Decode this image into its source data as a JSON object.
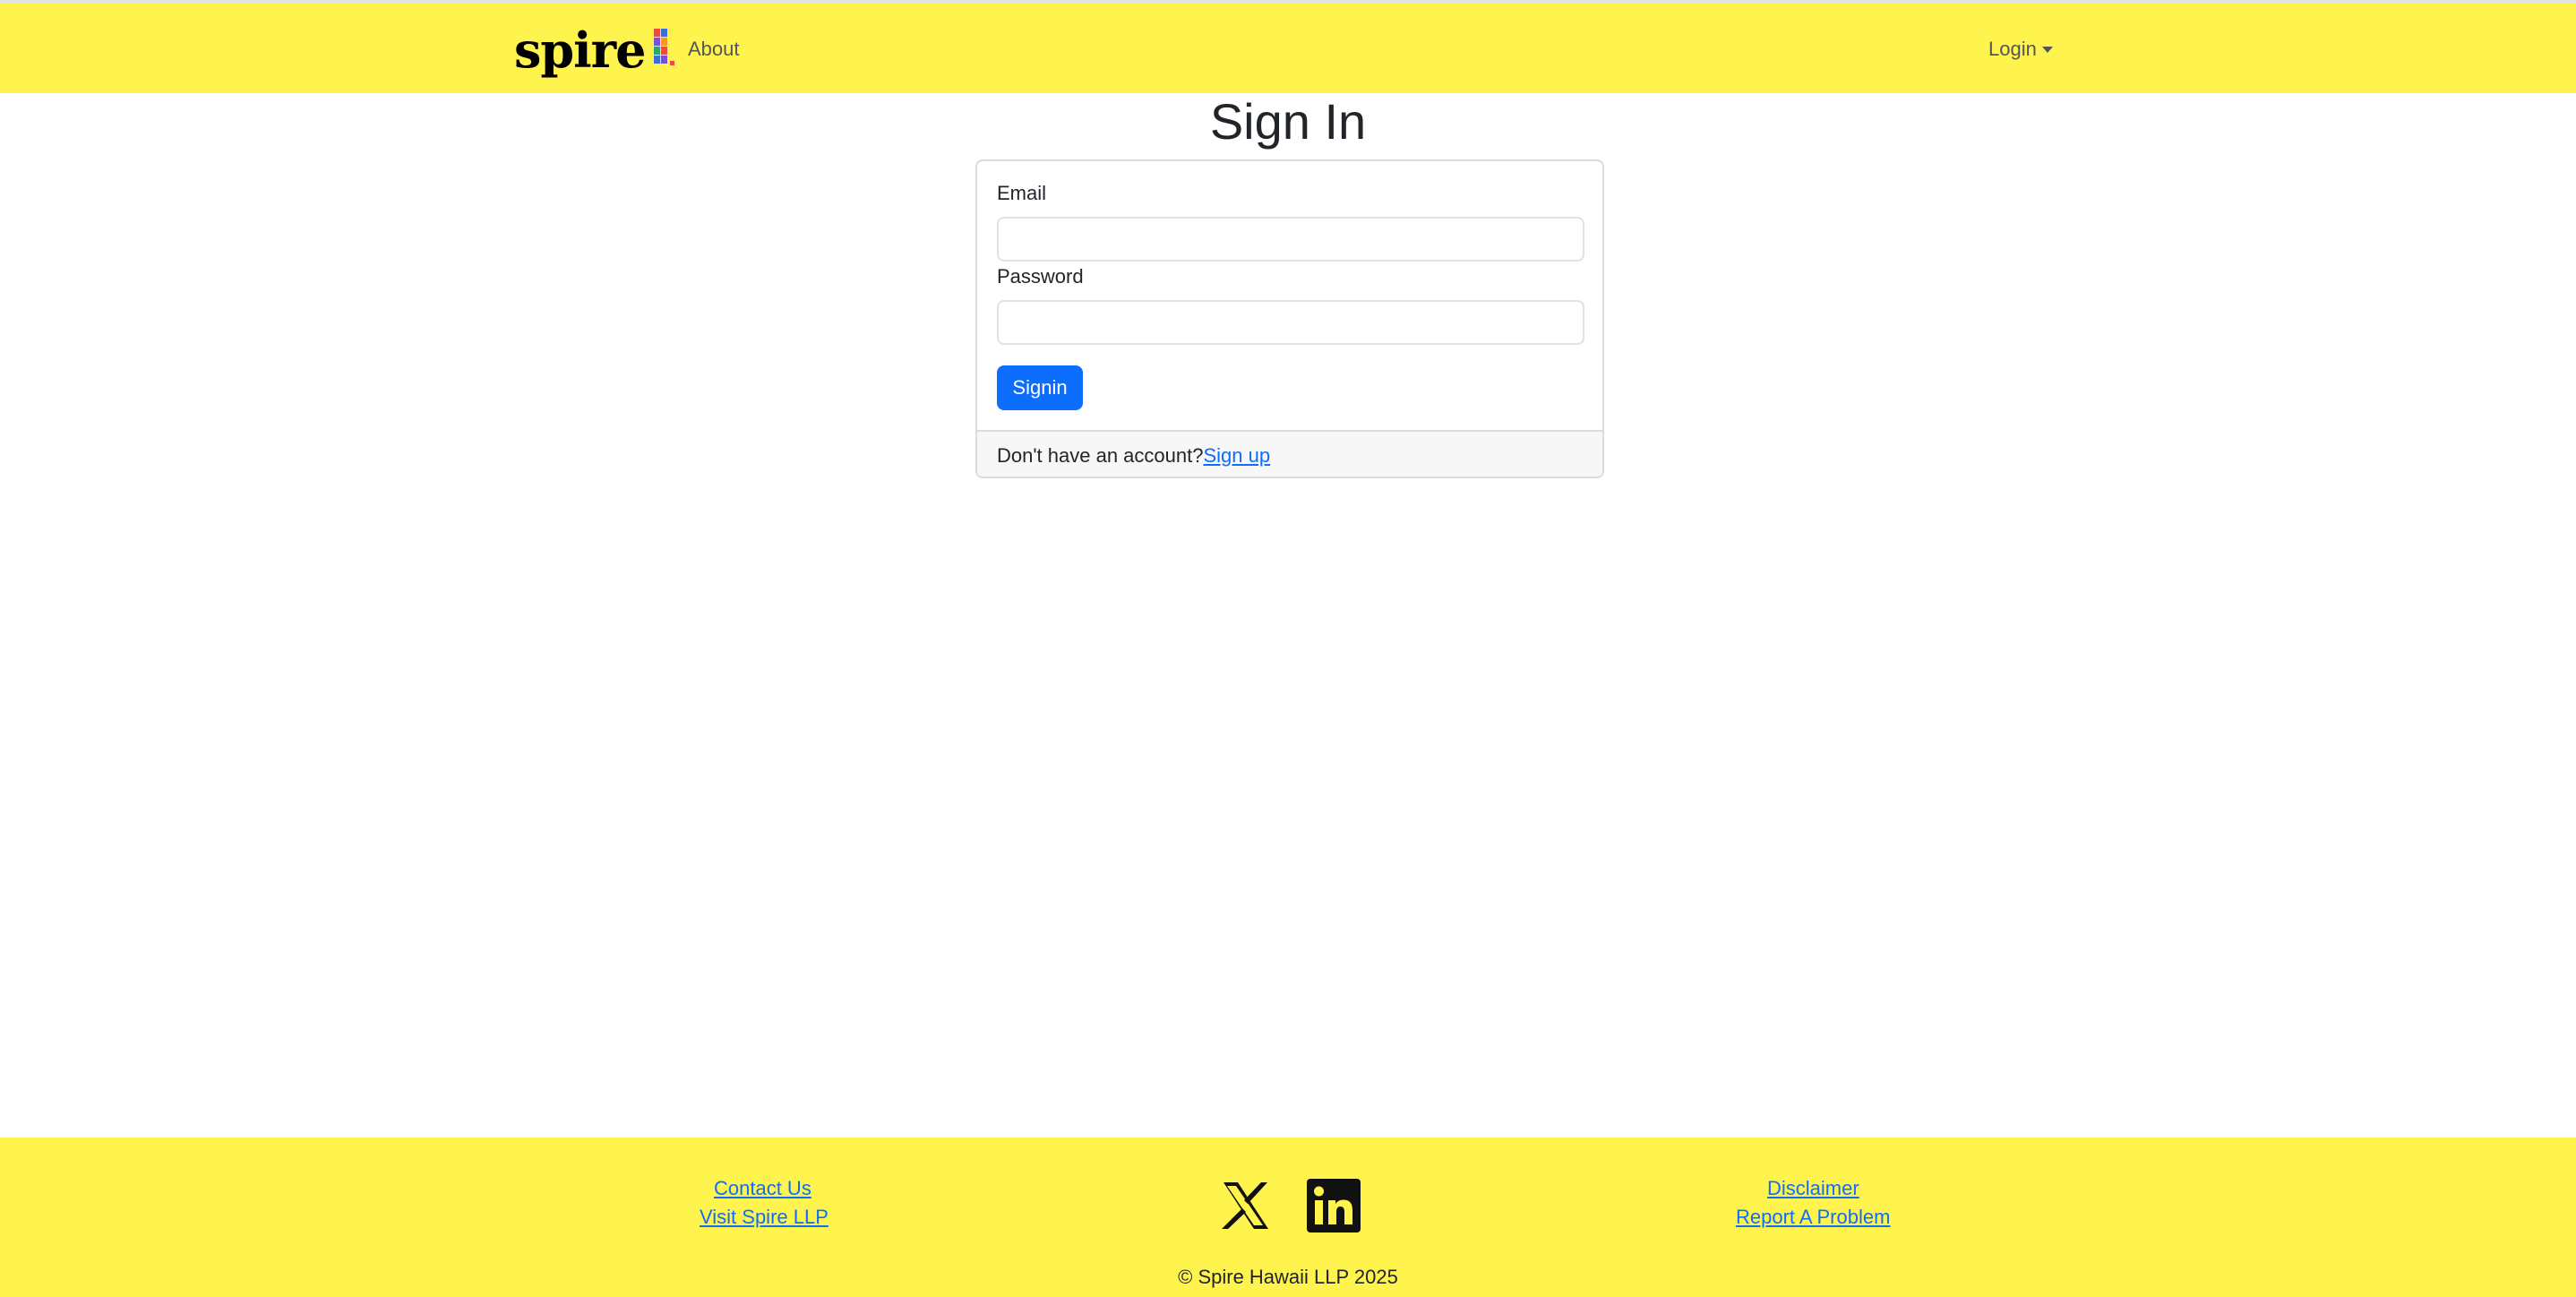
{
  "nav": {
    "brand": "spire",
    "about": "About",
    "login": "Login"
  },
  "page_title": "Sign In",
  "form": {
    "email_label": "Email",
    "email_value": "",
    "password_label": "Password",
    "password_value": "",
    "submit_label": "Signin"
  },
  "card_footer": {
    "prompt": "Don't have an account?",
    "signup_link": "Sign up"
  },
  "footer": {
    "contact": "Contact Us",
    "visit": "Visit Spire LLP",
    "disclaimer": "Disclaimer",
    "report": "Report A Problem",
    "copyright": "© Spire Hawaii LLP 2025",
    "icons": [
      "x-icon",
      "linkedin-icon"
    ]
  },
  "colors": {
    "navbar": "#fff34d",
    "primary": "#0d6efd"
  }
}
